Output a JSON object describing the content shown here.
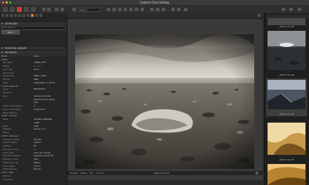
{
  "window": {
    "title": "Capture One catalog"
  },
  "toolbar": {
    "layer_label": "Layer 1",
    "icons": [
      "import-icon",
      "camera-icon",
      "adjust-icon",
      "brush-icon",
      "share-icon",
      "cursor-icon",
      "crop-icon",
      "rotate-icon",
      "keystone-icon",
      "spot-icon",
      "picker-icon",
      "eyedropper-icon",
      "settings-icon",
      "help-icon"
    ]
  },
  "left_panel": {
    "sections": {
      "keywords": "KEYWORDS",
      "keyword_library": "KEYWORD LIBRARY",
      "metadata": "METADATA"
    },
    "keyword_placeholder": "Enter keyword",
    "search_button": "Search",
    "metadata_columns": {
      "name": "Name",
      "value": "Value"
    },
    "metadata": [
      {
        "group": true,
        "key": "Basic"
      },
      {
        "key": "File name",
        "value": "_EM85-2767"
      },
      {
        "key": "Rating",
        "value": "• • • • •"
      },
      {
        "key": "Color Tag",
        "value": "None"
      },
      {
        "key": "Color space",
        "value": ""
      },
      {
        "key": "Dimensions",
        "value": "4608 x 3456"
      },
      {
        "key": "Format",
        "value": "RAW"
      },
      {
        "key": "Date",
        "value": "27/04/2016, 17:46:31"
      },
      {
        "group": true,
        "key": "Vendor Specific"
      },
      {
        "key": "Serial",
        "value": "BHP509543"
      },
      {
        "key": "Firmware",
        "value": ""
      },
      {
        "key": "Lens",
        "value": "Olympus M.Zuiko"
      },
      {
        "key": "",
        "value": "DIGITAL ED 12-40mm"
      },
      {
        "key": "",
        "value": "F2.8"
      },
      {
        "key": "Flash compensation",
        "value": "0"
      },
      {
        "key": "Drive mode/Shutt...",
        "value": "Single Shot"
      },
      {
        "key": "White balance",
        "value": ""
      },
      {
        "group": true,
        "key": "EXIF - Camera"
      },
      {
        "key": "Make",
        "value": "OLYMPUS IMAGING"
      },
      {
        "key": "",
        "value": "CORP."
      },
      {
        "key": "Model",
        "value": "E-M5"
      },
      {
        "key": "Software",
        "value": "Version 1.2"
      },
      {
        "key": "Owner",
        "value": ""
      },
      {
        "group": true,
        "key": "EXIF - Exposure"
      },
      {
        "key": "ISO speed rating",
        "value": "ISO 200"
      },
      {
        "key": "Shutter speed",
        "value": "1/400 s"
      },
      {
        "key": "Aperture",
        "value": "f/8"
      },
      {
        "key": "Exposure comp...",
        "value": "0"
      },
      {
        "key": "Flash mode",
        "value": "Auto, Did not fire"
      },
      {
        "key": "Exposure program",
        "value": "Aperture priority AE"
      },
      {
        "key": "Exposure mode",
        "value": "Auto"
      },
      {
        "key": "Metering mode",
        "value": "Pattern"
      },
      {
        "key": "Focal length",
        "value": "12 mm"
      },
      {
        "key": "White balance",
        "value": "Manual"
      },
      {
        "group": true,
        "key": "EXIF - GPS"
      },
      {
        "key": "Latitude",
        "value": ""
      },
      {
        "key": "Longitude",
        "value": ""
      }
    ]
  },
  "viewer": {
    "info_left": [
      "ISO 200",
      "1/400 s",
      "f/8",
      "12 mm"
    ],
    "info_center": "_EM85-2767.ORF"
  },
  "filmstrip": [
    {
      "caption": "_EM85-2770.ORF",
      "stars": "• • • • •"
    },
    {
      "caption": "_EM85-2768.ORF",
      "stars": "• • • • •"
    },
    {
      "caption": "_EM85-2767.ORF",
      "stars": "• • • • •"
    },
    {
      "caption": "_EM85-2769.ORF",
      "stars": "• • • • •"
    }
  ],
  "colors": {
    "accent": "#e07b1e",
    "panel": "#262626",
    "viewer_bg": "#3a3a3a"
  }
}
